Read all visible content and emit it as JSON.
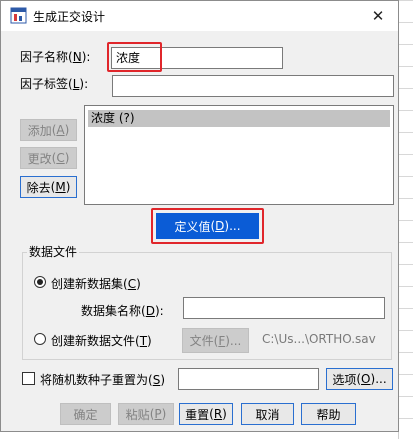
{
  "dialog": {
    "title": "生成正交设计",
    "close_glyph": "✕"
  },
  "factor": {
    "name_label": "因子名称",
    "name_key": "N",
    "name_value": "浓度",
    "tag_label": "因子标签",
    "tag_key": "L",
    "tag_value": ""
  },
  "list_buttons": {
    "add": "添加",
    "add_key": "A",
    "change": "更改",
    "change_key": "C",
    "remove": "除去",
    "remove_key": "M"
  },
  "factor_list": {
    "items": [
      "浓度 (?)"
    ]
  },
  "define_values": {
    "label": "定义值",
    "key": "D",
    "suffix": "..."
  },
  "data_file": {
    "group_title": "数据文件",
    "option_new_dataset": "创建新数据集",
    "option_new_dataset_key": "C",
    "dataset_name_label": "数据集名称",
    "dataset_name_key": "D",
    "dataset_name_value": "",
    "option_new_file": "创建新数据文件",
    "option_new_file_key": "T",
    "file_button": "文件",
    "file_button_key": "F",
    "file_button_suffix": "...",
    "file_path": "C:\\Us...\\ORTHO.sav"
  },
  "seed": {
    "label": "将随机数种子重置为",
    "key": "S",
    "value": "",
    "options_button": "选项",
    "options_key": "O",
    "options_suffix": "..."
  },
  "footer": {
    "ok": "确定",
    "paste": "粘贴",
    "paste_key": "P",
    "reset": "重置",
    "reset_key": "R",
    "cancel": "取消",
    "help": "帮助"
  },
  "colors": {
    "accent": "#0b5cd6",
    "highlight_border": "#e0262b",
    "selection": "#c3c3c3",
    "dialog_bg": "#f0f0f0"
  },
  "icons": [
    "app-icon",
    "close-icon"
  ]
}
